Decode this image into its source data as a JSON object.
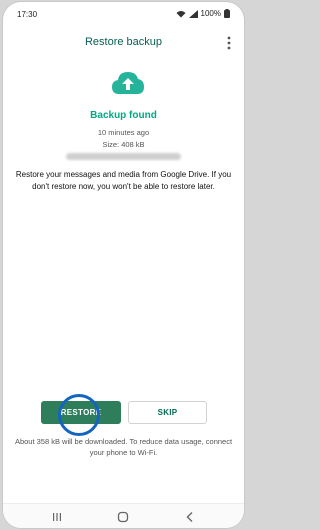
{
  "status_bar": {
    "time": "17:30",
    "battery": "100%"
  },
  "app_bar": {
    "title": "Restore backup"
  },
  "backup": {
    "heading": "Backup found",
    "time": "10 minutes ago",
    "size": "Size: 408 kB",
    "description": "Restore your messages and media from Google Drive. If you don't restore now, you won't be able to restore later."
  },
  "actions": {
    "restore_label": "RESTORE",
    "skip_label": "SKIP"
  },
  "footer_note": "About 358 kB will be downloaded. To reduce data usage, connect your phone to Wi-Fi.",
  "colors": {
    "accent": "#00a884",
    "title": "#075e54",
    "button": "#2e7d5b",
    "highlight_ring": "#1565c0"
  },
  "icons": [
    "wifi-icon",
    "signal-icon",
    "battery-icon",
    "more-vert-icon",
    "cloud-upload-icon",
    "recent-apps-icon",
    "home-icon",
    "back-icon"
  ]
}
